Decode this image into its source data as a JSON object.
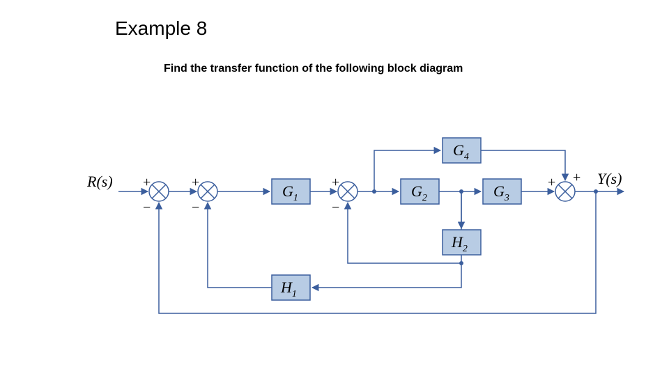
{
  "title": "Example 8",
  "prompt": "Find the transfer function of the following block diagram",
  "input_label": "R(s)",
  "output_label": "Y(s)",
  "blocks": {
    "G1": {
      "label": "G",
      "sub": "1"
    },
    "G2": {
      "label": "G",
      "sub": "2"
    },
    "G3": {
      "label": "G",
      "sub": "3"
    },
    "G4": {
      "label": "G",
      "sub": "4"
    },
    "H1": {
      "label": "H",
      "sub": "1"
    },
    "H2": {
      "label": "H",
      "sub": "2"
    }
  },
  "summing_junctions": {
    "S1": {
      "inputs": [
        {
          "sign": "+",
          "pos": "left-top"
        },
        {
          "sign": "−",
          "pos": "bottom-left"
        }
      ]
    },
    "S2": {
      "inputs": [
        {
          "sign": "+",
          "pos": "left-top"
        },
        {
          "sign": "−",
          "pos": "bottom-left"
        }
      ]
    },
    "S3": {
      "inputs": [
        {
          "sign": "+",
          "pos": "left-top"
        },
        {
          "sign": "−",
          "pos": "bottom-left"
        }
      ]
    },
    "S4": {
      "inputs": [
        {
          "sign": "+",
          "pos": "top-right"
        },
        {
          "sign": "+",
          "pos": "left-top"
        }
      ]
    }
  },
  "signs": {
    "plus": "+",
    "minus": "−"
  },
  "colors": {
    "block_fill": "#b8cce4",
    "line": "#3b5e9d"
  }
}
